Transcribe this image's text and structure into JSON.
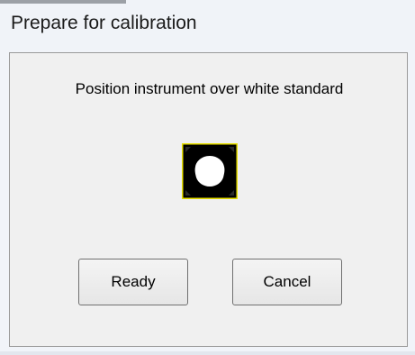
{
  "window": {
    "title": "Prepare for calibration"
  },
  "dialog": {
    "message": "Position instrument over white standard",
    "icon": "instrument-over-white-standard-icon",
    "buttons": {
      "ready_label": "Ready",
      "cancel_label": "Cancel"
    }
  },
  "colors": {
    "icon_frame": "#e8e000",
    "icon_background": "#000000",
    "icon_disc": "#ffffff"
  }
}
